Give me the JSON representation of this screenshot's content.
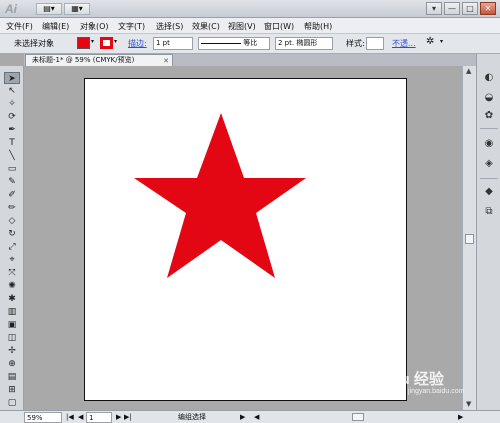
{
  "app": {
    "logo": "Ai",
    "title_buttons": [
      "▤▾",
      "▦▾"
    ],
    "window_controls": [
      "▾",
      "—",
      "□",
      "✕"
    ]
  },
  "menu": [
    "文件(F)",
    "编辑(E)",
    "对象(O)",
    "文字(T)",
    "选择(S)",
    "效果(C)",
    "视图(V)",
    "窗口(W)",
    "帮助(H)"
  ],
  "control": {
    "selection_label": "未选择对象",
    "stroke_link": "描边:",
    "stroke_weight": "1 pt",
    "stroke_profile": "等比",
    "brush": "2 pt. 椭圆形",
    "style_label": "样式:",
    "opacity_link": "不透...",
    "fill_color": "#e30613",
    "stroke_color": "#e30613"
  },
  "document": {
    "tab_label": "未标题-1* @ 59% (CMYK/预览)",
    "tab_close": "✕"
  },
  "tools": [
    "➤",
    "↖",
    "✧",
    "⟳",
    "✒",
    "T",
    "╲",
    "▭",
    "✎",
    "✐",
    "✏",
    "◇",
    "↻",
    "⤢",
    "⌖",
    "⤧",
    "✺",
    "✱",
    "▥",
    "▣",
    "◫",
    "✢",
    "⊕",
    "▤",
    "⊞",
    "⌗",
    "⚗",
    "⚙",
    "✋",
    "🔍",
    "◧",
    "▢"
  ],
  "panel_icons": [
    "◐",
    "◒",
    "✿",
    "◉",
    "◈",
    "◆",
    "⧉"
  ],
  "artwork": {
    "shape": "star",
    "fill": "#e30613"
  },
  "status": {
    "zoom": "59%",
    "artboard_number": "1",
    "tool_state": "编组选择",
    "nav_prev": "◀",
    "nav_next": "▶",
    "play": "▶"
  },
  "watermark": {
    "text": "Baidu 经验",
    "sub": "jingyan.baidu.com"
  }
}
